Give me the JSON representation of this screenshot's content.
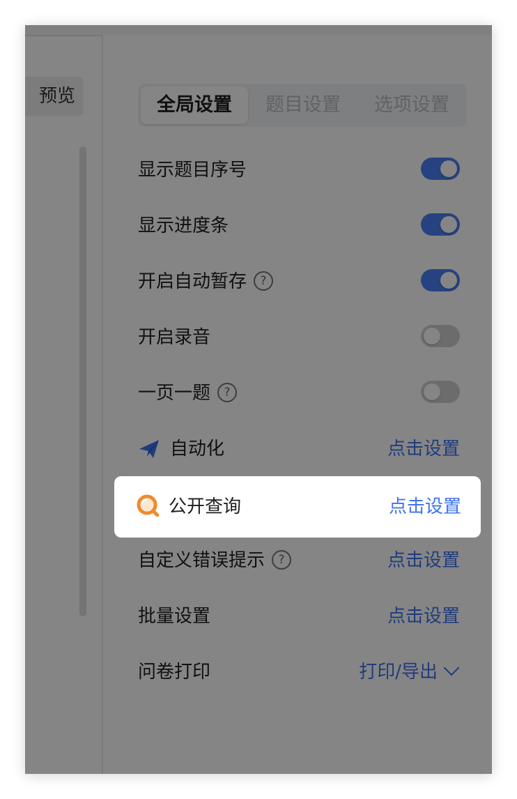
{
  "preview_label": "预览",
  "tabs": [
    {
      "label": "全局设置",
      "active": true
    },
    {
      "label": "题目设置",
      "active": false
    },
    {
      "label": "选项设置",
      "active": false
    }
  ],
  "toggles": [
    {
      "label": "显示题目序号",
      "on": true,
      "help": false
    },
    {
      "label": "显示进度条",
      "on": true,
      "help": false
    },
    {
      "label": "开启自动暂存",
      "on": true,
      "help": true
    },
    {
      "label": "开启录音",
      "on": false,
      "help": false
    },
    {
      "label": "一页一题",
      "on": false,
      "help": true
    }
  ],
  "help_glyph": "?",
  "automation": {
    "label": "自动化",
    "action": "点击设置",
    "icon": "paper-plane-icon"
  },
  "public_query": {
    "label": "公开查询",
    "action": "点击设置",
    "icon": "search-icon"
  },
  "custom_error": {
    "label": "自定义错误提示",
    "action": "点击设置"
  },
  "batch": {
    "label": "批量设置",
    "action": "点击设置"
  },
  "print": {
    "label": "问卷打印",
    "action": "打印/导出"
  },
  "colors": {
    "accent": "#3f73ee",
    "toggle_on": "#4a7ff5",
    "query_icon": "#f08a2c"
  }
}
